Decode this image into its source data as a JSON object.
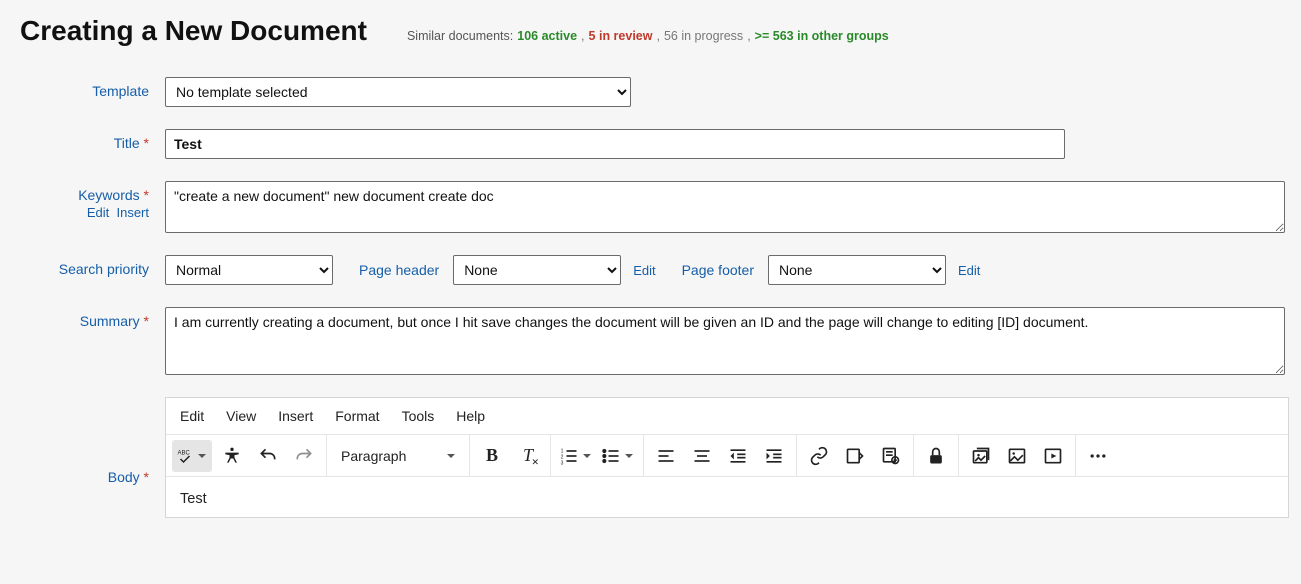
{
  "header": {
    "title": "Creating a New Document",
    "similar_label": "Similar documents:",
    "active_count": "106",
    "active_label": "active",
    "in_review_count": "5",
    "in_review_label": "in review",
    "in_progress_count": "56",
    "in_progress_label": "in progress",
    "other_groups_prefix": ">= 563",
    "other_groups_label": "in other groups"
  },
  "labels": {
    "template": "Template",
    "title": "Title",
    "keywords": "Keywords",
    "keywords_edit": "Edit",
    "keywords_insert": "Insert",
    "search_priority": "Search priority",
    "page_header": "Page header",
    "page_footer": "Page footer",
    "summary": "Summary",
    "body": "Body",
    "edit_link": "Edit"
  },
  "fields": {
    "template_value": "No template selected",
    "title_value": "Test",
    "keywords_value": "\"create a new document\" new document create doc",
    "priority_value": "Normal",
    "header_value": "None",
    "footer_value": "None",
    "summary_value": "I am currently creating a document, but once I hit save changes the document will be given an ID and the page will change to editing [ID] document."
  },
  "editor": {
    "menu": {
      "edit": "Edit",
      "view": "View",
      "insert": "Insert",
      "format": "Format",
      "tools": "Tools",
      "help": "Help"
    },
    "style_select": "Paragraph",
    "body_text": "Test"
  }
}
